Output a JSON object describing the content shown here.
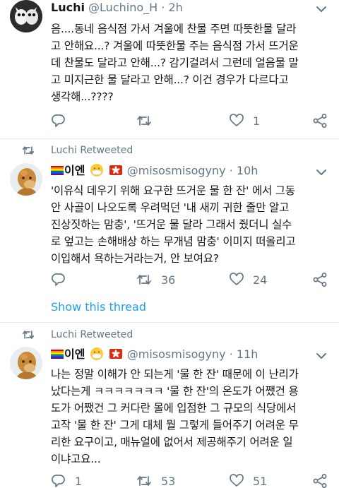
{
  "tweets": [
    {
      "name": "Luchi",
      "handle": "@Luchino_H",
      "sep": "·",
      "time": "2h",
      "lines": [
        "음....동네 음식점 가서 겨울에 찬물 주면 따뜻한물 달라",
        "고 안해요...? 겨울에 따뜻한물 주는 음식점 가서 뜨거운",
        "데 찬물도 달라고 안해...? 감기걸려서 그런데 얼음물 말",
        "고 미지근한 물 달라고 안해...? 이건 경우가 다르다고",
        "생각해...????"
      ],
      "replies": "",
      "retweets": "",
      "likes": "1"
    },
    {
      "retweet_label": "Luchi Retweeted",
      "name": "이엔",
      "handle": "@misosmisogyny",
      "sep": "·",
      "time": "10h",
      "lines": [
        "'이유식 데우기 위해 요구한 뜨거운 물 한 잔' 에서 그동",
        "안 사골이 나오도록 우려먹던 '내 새끼 귀한 줄만 알고",
        "진상짓하는 맘충', '뜨거운 물 달라 그래서 줬더니 실수",
        "로 엎고는 손해배상 하는 무개념 맘충' 이미지 떠올리고",
        "이입해서 욕하는거라는거, 안 보여요?"
      ],
      "replies": "",
      "retweets": "36",
      "likes": "24",
      "show_thread": "Show this thread"
    },
    {
      "retweet_label": "Luchi Retweeted",
      "name": "이엔",
      "handle": "@misosmisogyny",
      "sep": "·",
      "time": "11h",
      "lines": [
        "나는 정말 이해가 안 되는게 '물 한 잔' 때문에 이 난리가",
        "났다는게 ㅋㅋㅋㅋㅋㅋㅋ '물 한 잔'의 온도가 어쨌건 용",
        "도가 어쨌건 그 커다란 몰에 입점한 그 규모의 식당에서",
        "고작 '물 한 잔' 그게 대체 뭘 그렇게 들어주기 어려운 무",
        "리한 요구이고, 매뉴얼에 없어서 제공해주기 어려운 일",
        "이냐고요..."
      ],
      "replies": "1",
      "retweets": "53",
      "likes": "51"
    }
  ],
  "icons": {
    "reply": "reply-icon",
    "retweet": "retweet-icon",
    "like": "heart-icon",
    "share": "share-icon",
    "menu": "chevron-down-icon"
  },
  "colors": {
    "text": "#14171a",
    "meta": "#657786",
    "link": "#1da1f2",
    "divider": "#e6ecf0"
  }
}
